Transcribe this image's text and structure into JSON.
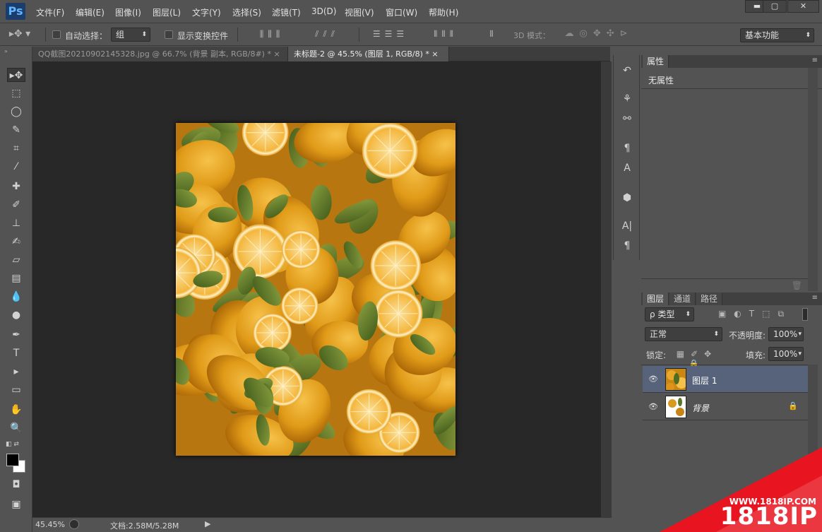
{
  "app": {
    "logo": "Ps"
  },
  "menu": [
    "文件(F)",
    "编辑(E)",
    "图像(I)",
    "图层(L)",
    "文字(Y)",
    "选择(S)",
    "滤镜(T)",
    "3D(D)",
    "视图(V)",
    "窗口(W)",
    "帮助(H)"
  ],
  "window_controls": {
    "minimize": "▬",
    "maximize": "▢",
    "close": "✕"
  },
  "options": {
    "auto_select_label": "自动选择：",
    "auto_select_value": "组",
    "show_transform_label": "显示变换控件",
    "mode_3d_label": "3D 模式：",
    "workspace": "基本功能"
  },
  "tabs": [
    {
      "label": "QQ截图20210902145328.jpg @ 66.7% (背景 副本, RGB/8#) *",
      "close": "×",
      "active": false
    },
    {
      "label": "未标题-2 @ 45.5% (图层 1, RGB/8) *",
      "close": "×",
      "active": true
    }
  ],
  "status": {
    "zoom": "45.45%",
    "doc": "文档:2.58M/5.28M"
  },
  "properties": {
    "tab": "属性",
    "content": "无属性"
  },
  "layers_panel": {
    "tabs": [
      "图层",
      "通道",
      "路径"
    ],
    "filter_label": "ρ 类型",
    "blend_mode": "正常",
    "opacity_label": "不透明度:",
    "opacity_value": "100%",
    "lock_label": "锁定:",
    "fill_label": "填充:",
    "fill_value": "100%",
    "layers": [
      {
        "name": "图层 1",
        "selected": true,
        "locked": false
      },
      {
        "name": "背景",
        "selected": false,
        "locked": true
      }
    ]
  },
  "watermark": {
    "url": "WWW.1818IP.COM",
    "brand": "1818IP"
  },
  "colors": {
    "accent": "#e8141f",
    "selected_layer": "#56637a",
    "canvas_bg": "#282828"
  }
}
